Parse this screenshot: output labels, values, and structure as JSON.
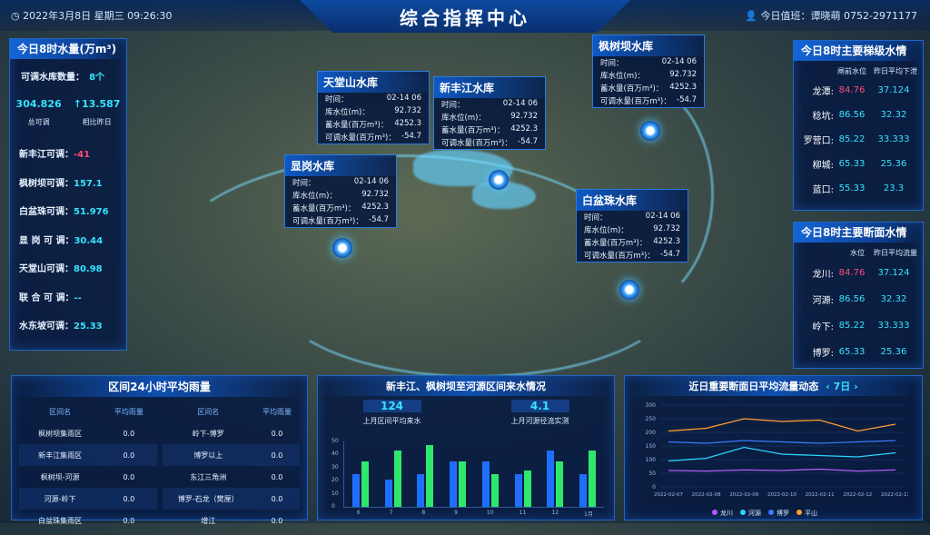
{
  "header": {
    "datetime": "2022年3月8日  星期三  09:26:30",
    "title": "综合指挥中心",
    "duty": "今日值班：谭晓萌 0752-2971177"
  },
  "left": {
    "title": "今日8时水量(万m³)",
    "adjustable_count_label": "可调水库数量：",
    "adjustable_count": "8个",
    "total": "304.826",
    "total_label": "总可调",
    "change": "↑13.587",
    "change_label": "相比昨日",
    "items": [
      {
        "label": "新丰江可调：",
        "value": "-41",
        "neg": true
      },
      {
        "label": "枫树坝可调：",
        "value": "157.1"
      },
      {
        "label": "白盆珠可调：",
        "value": "51.976"
      },
      {
        "label": "显 岗 可 调：",
        "value": "30.44"
      },
      {
        "label": "天堂山可调：",
        "value": "80.98"
      },
      {
        "label": "联 合 可 调：",
        "value": "--"
      },
      {
        "label": "水东坡可调：",
        "value": "25.33"
      }
    ]
  },
  "reservoir_labels": {
    "time": "时间：",
    "level": "库水位(m)：",
    "storage": "蓄水量(百万m³)：",
    "adjust": "可调水量(百万m³)："
  },
  "reservoirs": [
    {
      "name": "天堂山水库",
      "time": "02-14 06",
      "level": "92.732",
      "storage": "4252.3",
      "adjust": "-54.7"
    },
    {
      "name": "新丰江水库",
      "time": "02-14 06",
      "level": "92.732",
      "storage": "4252.3",
      "adjust": "-54.7"
    },
    {
      "name": "枫树坝水库",
      "time": "02-14 06",
      "level": "92.732",
      "storage": "4252.3",
      "adjust": "-54.7"
    },
    {
      "name": "显岗水库",
      "time": "02-14 06",
      "level": "92.732",
      "storage": "4252.3",
      "adjust": "-54.7"
    },
    {
      "name": "白盆珠水库",
      "time": "02-14 06",
      "level": "92.732",
      "storage": "4252.3",
      "adjust": "-54.7"
    }
  ],
  "right_top": {
    "title": "今日8时主要梯级水情",
    "col1": "闸前水位",
    "col2": "昨日平均下泄",
    "rows": [
      {
        "name": "龙潭:",
        "a": "84.76",
        "b": "37.124",
        "neg": true
      },
      {
        "name": "稔坑:",
        "a": "86.56",
        "b": "32.32"
      },
      {
        "name": "罗营口:",
        "a": "85.22",
        "b": "33.333"
      },
      {
        "name": "柳城:",
        "a": "65.33",
        "b": "25.36"
      },
      {
        "name": "蓝口:",
        "a": "55.33",
        "b": "23.3"
      }
    ]
  },
  "right_bottom": {
    "title": "今日8时主要断面水情",
    "col1": "水位",
    "col2": "昨日平均流量",
    "rows": [
      {
        "name": "龙川:",
        "a": "84.76",
        "b": "37.124",
        "neg": true
      },
      {
        "name": "河源:",
        "a": "86.56",
        "b": "32.32"
      },
      {
        "name": "岭下:",
        "a": "85.22",
        "b": "33.333"
      },
      {
        "name": "博罗:",
        "a": "65.33",
        "b": "25.36"
      }
    ]
  },
  "rain": {
    "title": "区间24小时平均雨量",
    "h1": "区间名",
    "h2": "平均雨量",
    "left": [
      {
        "n": "枫树坝集雨区",
        "v": "0.0"
      },
      {
        "n": "新丰江集雨区",
        "v": "0.0"
      },
      {
        "n": "枫树坝-河源",
        "v": "0.0"
      },
      {
        "n": "河源-岭下",
        "v": "0.0"
      },
      {
        "n": "白盆珠集雨区",
        "v": "0.0"
      }
    ],
    "right": [
      {
        "n": "岭下-博罗",
        "v": "0.0"
      },
      {
        "n": "博罗以上",
        "v": "0.0"
      },
      {
        "n": "东江三角洲",
        "v": "0.0"
      },
      {
        "n": "博罗-石龙（樊厘）",
        "v": "0.0"
      },
      {
        "n": "增江",
        "v": "0.0"
      }
    ]
  },
  "inflow": {
    "title": "新丰江、枫树坝至河源区间来水情况",
    "s1": "124",
    "s1_label": "上月区间平均来水",
    "s2": "4.1",
    "s2_label": "上月河源径流实测",
    "chart_data": {
      "type": "bar",
      "categories": [
        "6",
        "7",
        "8",
        "9",
        "10",
        "11",
        "12",
        "1月"
      ],
      "ylim": [
        0,
        50
      ],
      "yticks": [
        "50",
        "40",
        "30",
        "20",
        "10",
        "0"
      ],
      "series": [
        {
          "color": "#1e6fff",
          "values": [
            25,
            21,
            25,
            35,
            35,
            25,
            43,
            25
          ]
        },
        {
          "color": "#2ee86c",
          "values": [
            35,
            43,
            47,
            35,
            25,
            28,
            35,
            43
          ]
        }
      ]
    }
  },
  "flow": {
    "title": "近日重要断面日平均流量动态",
    "range": "7日",
    "chart_data": {
      "type": "line",
      "x": [
        "2022-02-07",
        "2022-02-08",
        "2022-02-09",
        "2022-02-10",
        "2022-02-11",
        "2022-02-12",
        "2022-02-13"
      ],
      "ylim": [
        0,
        300
      ],
      "yticks": [
        "300",
        "250",
        "200",
        "150",
        "100",
        "50",
        "0"
      ],
      "series": [
        {
          "name": "龙川",
          "color": "#b45cff",
          "values": [
            60,
            58,
            62,
            60,
            65,
            58,
            62
          ]
        },
        {
          "name": "河源",
          "color": "#2ad4ff",
          "values": [
            95,
            105,
            145,
            120,
            115,
            110,
            125
          ]
        },
        {
          "name": "博罗",
          "color": "#3b7bff",
          "values": [
            165,
            160,
            170,
            165,
            160,
            165,
            170
          ]
        },
        {
          "name": "平山",
          "color": "#ff9f2e",
          "values": [
            205,
            215,
            250,
            240,
            245,
            205,
            230
          ]
        }
      ]
    }
  }
}
